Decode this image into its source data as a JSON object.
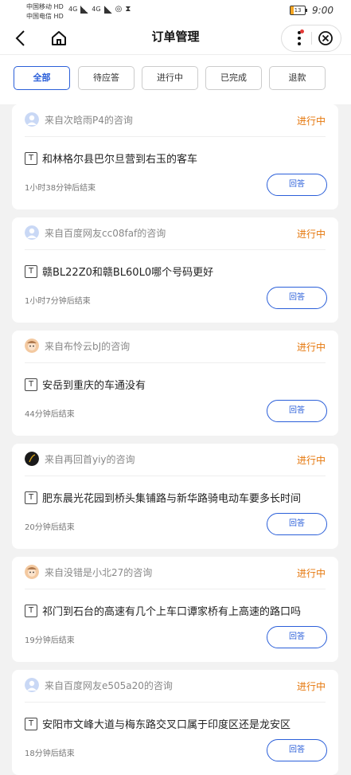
{
  "statusbar": {
    "carrier1": "中国移动",
    "carrier2": "中国电信",
    "hd1": "HD",
    "hd2": "HD",
    "net1": "4G",
    "net2": "4G",
    "battery": "13",
    "time": "9:00"
  },
  "nav": {
    "title": "订单管理"
  },
  "tabs": [
    {
      "label": "全部"
    },
    {
      "label": "待应答"
    },
    {
      "label": "进行中"
    },
    {
      "label": "已完成"
    },
    {
      "label": "退款"
    }
  ],
  "colors": {
    "accent": "#2b5fd9",
    "status": "#e5760a"
  },
  "orders": [
    {
      "from": "来自次晗雨P4的咨询",
      "status": "进行中",
      "question": "和林格尔县巴尔旦营到右玉的客车",
      "time": "1小时38分钟后结束",
      "button": "回答",
      "avatar": "default-avatar"
    },
    {
      "from": "来自百度网友cc08faf的咨询",
      "status": "进行中",
      "question": "赣BL22Z0和赣BL60L0哪个号码更好",
      "time": "1小时7分钟后结束",
      "button": "回答",
      "avatar": "default-avatar"
    },
    {
      "from": "来自布怜云bJ的咨询",
      "status": "进行中",
      "question": "安岳到重庆的车通没有",
      "time": "44分钟后结束",
      "button": "回答",
      "avatar": "cartoon-avatar"
    },
    {
      "from": "来自再回首yiy的咨询",
      "status": "进行中",
      "question": "肥东晨光花园到桥头集铺路与新华路骑电动车要多长时间",
      "time": "20分钟后结束",
      "button": "回答",
      "avatar": "dark-avatar"
    },
    {
      "from": "来自没错是小北27的咨询",
      "status": "进行中",
      "question": "祁门到石台的高速有几个上车口谭家桥有上高速的路口吗",
      "time": "19分钟后结束",
      "button": "回答",
      "avatar": "cartoon-avatar"
    },
    {
      "from": "来自百度网友e505a20的咨询",
      "status": "进行中",
      "question": "安阳市文峰大道与梅东路交叉口属于印度区还是龙安区",
      "time": "18分钟后结束",
      "button": "回答",
      "avatar": "default-avatar"
    }
  ]
}
